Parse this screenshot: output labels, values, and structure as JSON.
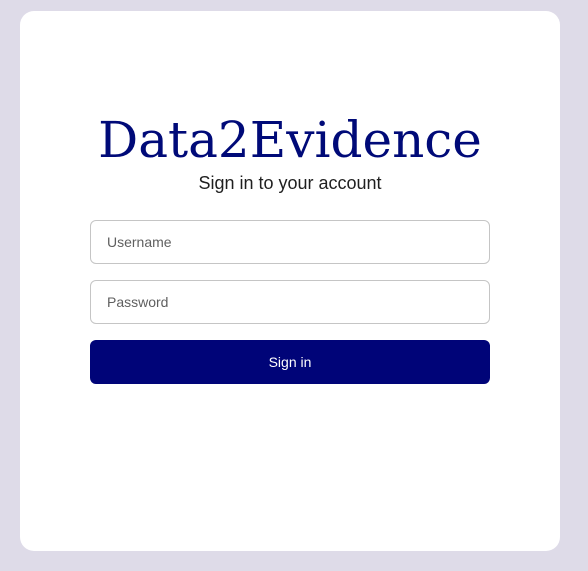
{
  "login": {
    "brand": "Data2Evidence",
    "subtitle": "Sign in to your account",
    "username_placeholder": "Username",
    "password_placeholder": "Password",
    "signin_label": "Sign in"
  },
  "colors": {
    "page_background": "#dedbe8",
    "card_background": "#ffffff",
    "brand": "#000a78",
    "button": "#000478",
    "button_text": "#ffffff"
  }
}
